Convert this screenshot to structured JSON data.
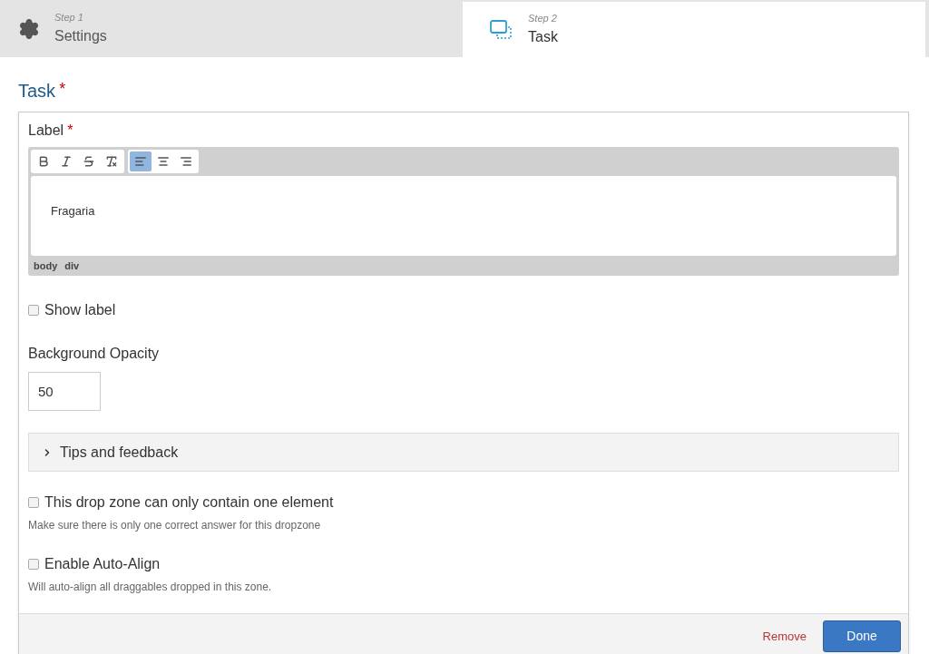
{
  "steps": [
    {
      "step": "Step 1",
      "label": "Settings",
      "kind": "settings",
      "selected": false
    },
    {
      "step": "Step 2",
      "label": "Task",
      "kind": "task",
      "selected": true
    }
  ],
  "section": {
    "title": "Task",
    "required_mark": "*"
  },
  "label_field": {
    "label": "Label",
    "required_mark": "*",
    "toolbar": [
      [
        {
          "kind": "bold",
          "selected": false
        },
        {
          "kind": "italic",
          "selected": false
        },
        {
          "kind": "strike",
          "selected": false
        },
        {
          "kind": "clear",
          "selected": false
        }
      ],
      [
        {
          "kind": "align-left",
          "selected": true
        },
        {
          "kind": "align-center",
          "selected": false
        },
        {
          "kind": "align-right",
          "selected": false
        }
      ]
    ],
    "value": "Fragaria",
    "path": [
      "body",
      "div"
    ]
  },
  "show_label": {
    "label": "Show label",
    "checked": false
  },
  "opacity": {
    "label": "Background Opacity",
    "value": "50"
  },
  "tips": {
    "label": "Tips and feedback",
    "expanded": false
  },
  "options": [
    {
      "label": "This drop zone can only contain one element",
      "hint": "Make sure there is only one correct answer for this dropzone",
      "checked": false
    },
    {
      "label": "Enable Auto-Align",
      "hint": "Will auto-align all draggables dropped in this zone.",
      "checked": false
    }
  ],
  "footer": {
    "remove": "Remove",
    "done": "Done"
  }
}
